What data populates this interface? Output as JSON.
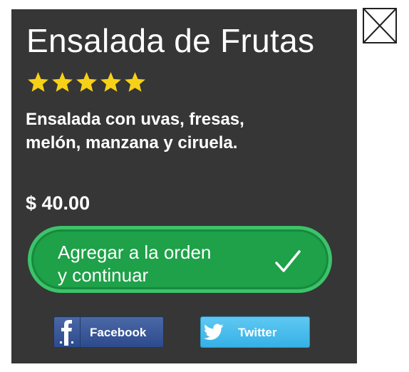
{
  "product": {
    "title": "Ensalada de Frutas",
    "rating": 5,
    "rating_max": 5,
    "description_lines": [
      "Ensalada con uvas, fresas,",
      "melón, manzana y ciruela."
    ],
    "price": "$ 40.00"
  },
  "add_button": {
    "label_lines": [
      "Agregar a la orden",
      "y continuar"
    ],
    "check_glyph": "✓"
  },
  "share": {
    "facebook_label": "Facebook",
    "twitter_label": "Twitter"
  },
  "icons": {
    "close": "close-icon",
    "star": "star-icon",
    "facebook": "facebook-logo-icon",
    "twitter": "twitter-bird-icon"
  },
  "colors": {
    "card_bg": "#363636",
    "star": "#f7d117",
    "button_green": "#1ea148",
    "button_border": "#3cc36b",
    "facebook": "#3b5998",
    "twitter": "#48bcec"
  }
}
